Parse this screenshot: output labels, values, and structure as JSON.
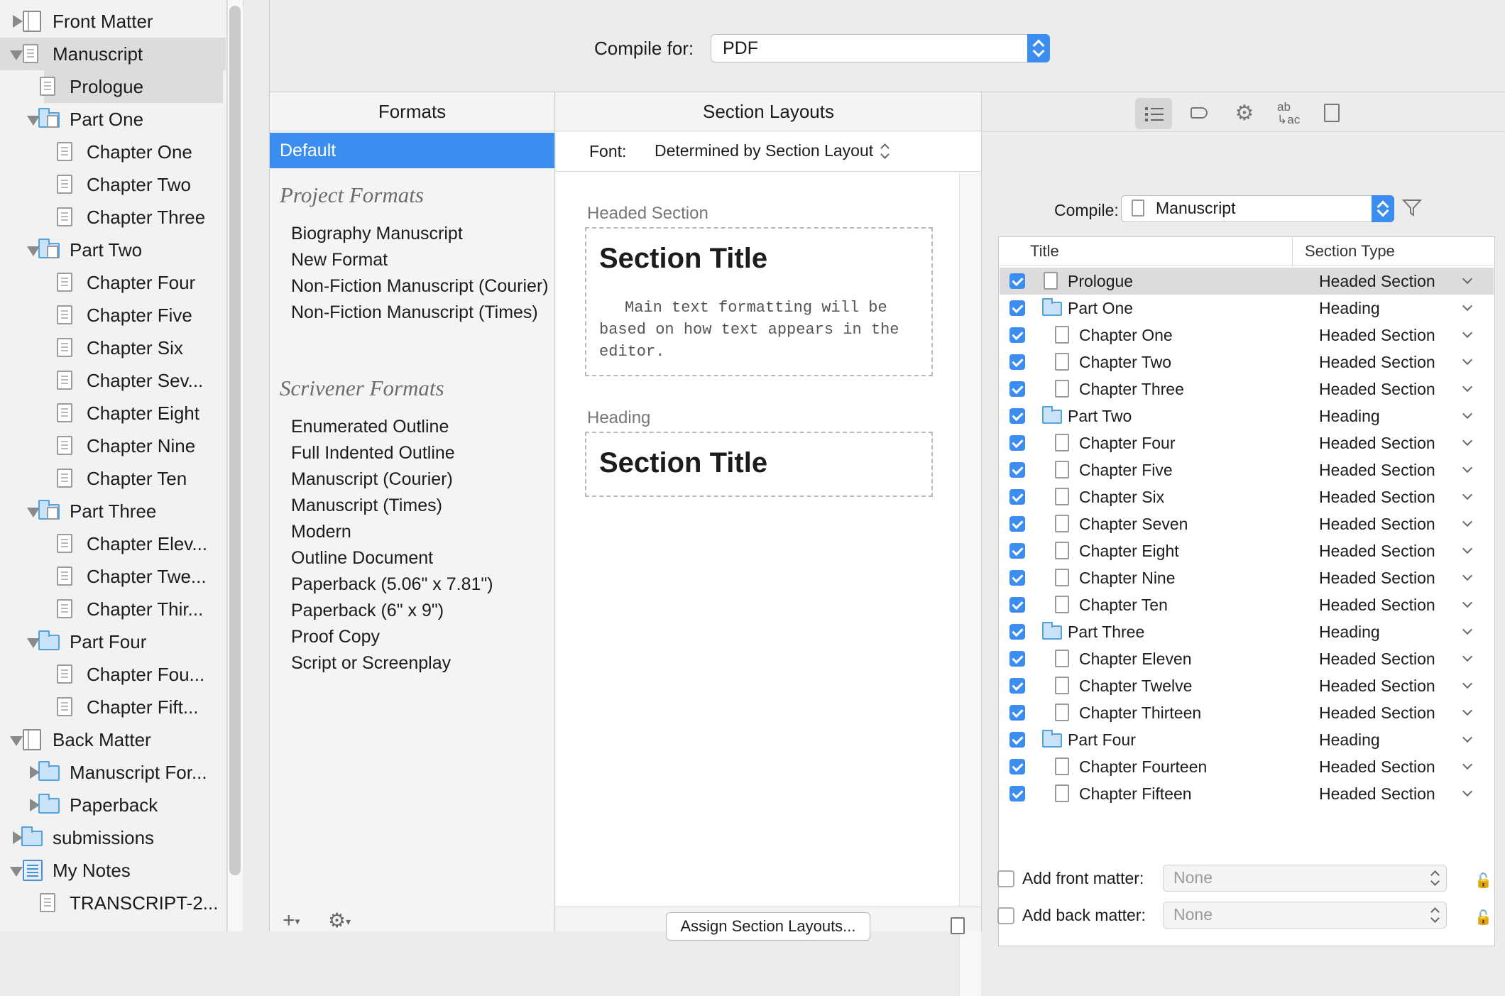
{
  "binder": {
    "items": [
      {
        "label": "Front Matter",
        "level": 0,
        "icon": "manuscript-icon",
        "tri": "c"
      },
      {
        "label": "Manuscript",
        "level": 0,
        "icon": "document-icon",
        "tri": "o",
        "selected": true
      },
      {
        "label": "Prologue",
        "level": 1,
        "icon": "document-icon",
        "tri": "",
        "selected2": true
      },
      {
        "label": "Part One",
        "level": 1,
        "icon": "folder-doc-icon",
        "tri": "o"
      },
      {
        "label": "Chapter One",
        "level": 2,
        "icon": "document-icon",
        "tri": ""
      },
      {
        "label": "Chapter Two",
        "level": 2,
        "icon": "document-icon",
        "tri": ""
      },
      {
        "label": "Chapter Three",
        "level": 2,
        "icon": "document-icon",
        "tri": ""
      },
      {
        "label": "Part Two",
        "level": 1,
        "icon": "folder-doc-icon",
        "tri": "o"
      },
      {
        "label": "Chapter Four",
        "level": 2,
        "icon": "document-icon",
        "tri": ""
      },
      {
        "label": "Chapter Five",
        "level": 2,
        "icon": "document-icon",
        "tri": ""
      },
      {
        "label": "Chapter Six",
        "level": 2,
        "icon": "document-icon",
        "tri": ""
      },
      {
        "label": "Chapter Sev...",
        "level": 2,
        "icon": "document-icon",
        "tri": ""
      },
      {
        "label": "Chapter Eight",
        "level": 2,
        "icon": "document-icon",
        "tri": ""
      },
      {
        "label": "Chapter Nine",
        "level": 2,
        "icon": "document-icon",
        "tri": ""
      },
      {
        "label": "Chapter Ten",
        "level": 2,
        "icon": "document-icon",
        "tri": ""
      },
      {
        "label": "Part Three",
        "level": 1,
        "icon": "folder-doc-icon",
        "tri": "o"
      },
      {
        "label": "Chapter Elev...",
        "level": 2,
        "icon": "document-icon",
        "tri": ""
      },
      {
        "label": "Chapter Twe...",
        "level": 2,
        "icon": "document-icon",
        "tri": ""
      },
      {
        "label": "Chapter Thir...",
        "level": 2,
        "icon": "document-icon",
        "tri": ""
      },
      {
        "label": "Part Four",
        "level": 1,
        "icon": "folder-icon",
        "tri": "o"
      },
      {
        "label": "Chapter Fou...",
        "level": 2,
        "icon": "document-icon",
        "tri": ""
      },
      {
        "label": "Chapter Fift...",
        "level": 2,
        "icon": "document-icon",
        "tri": ""
      },
      {
        "label": "Back Matter",
        "level": 0,
        "icon": "manuscript-icon",
        "tri": "o"
      },
      {
        "label": "Manuscript For...",
        "level": 1,
        "icon": "folder-icon",
        "tri": "c"
      },
      {
        "label": "Paperback",
        "level": 1,
        "icon": "folder-icon",
        "tri": "c"
      },
      {
        "label": "submissions",
        "level": 0,
        "icon": "folder-icon",
        "tri": "c"
      },
      {
        "label": "My Notes",
        "level": 0,
        "icon": "notebook-icon",
        "tri": "o"
      },
      {
        "label": "TRANSCRIPT-2...",
        "level": 1,
        "icon": "document-icon",
        "tri": ""
      }
    ]
  },
  "compile_for": {
    "label": "Compile for:",
    "value": "PDF"
  },
  "formats": {
    "header": "Formats",
    "default": "Default",
    "project_group": "Project Formats",
    "project": [
      "Biography Manuscript",
      "New Format",
      "Non-Fiction Manuscript (Courier)",
      "Non-Fiction Manuscript (Times)"
    ],
    "scrivener_group": "Scrivener Formats",
    "scrivener": [
      "Enumerated Outline",
      "Full Indented Outline",
      "Manuscript (Courier)",
      "Manuscript (Times)",
      "Modern",
      "Outline Document",
      "Paperback (5.06\" x 7.81\")",
      "Paperback (6\" x 9\")",
      "Proof Copy",
      "Script or Screenplay"
    ],
    "add_symbol": "+",
    "gear_symbol": "⚙"
  },
  "section_layouts": {
    "header": "Section Layouts",
    "font_label": "Font:",
    "font_value": "Determined by Section Layout",
    "layout1_name": "Headed Section",
    "layout1_title": "Section Title",
    "layout1_body": "Main text formatting will be based on how text appears in the editor.",
    "layout2_name": "Heading",
    "layout2_title": "Section Title",
    "assign_button": "Assign Section Layouts..."
  },
  "contents": {
    "compile_label": "Compile:",
    "compile_value": "Manuscript",
    "col_title": "Title",
    "col_type": "Section Type",
    "rows": [
      {
        "title": "Prologue",
        "type": "Headed Section",
        "kind": "doc",
        "indent": 0,
        "selected": true
      },
      {
        "title": "Part One",
        "type": "Heading",
        "kind": "folder",
        "indent": 0
      },
      {
        "title": "Chapter One",
        "type": "Headed Section",
        "kind": "doc",
        "indent": 1
      },
      {
        "title": "Chapter Two",
        "type": "Headed Section",
        "kind": "doc",
        "indent": 1
      },
      {
        "title": "Chapter Three",
        "type": "Headed Section",
        "kind": "doc",
        "indent": 1
      },
      {
        "title": "Part Two",
        "type": "Heading",
        "kind": "folder",
        "indent": 0
      },
      {
        "title": "Chapter Four",
        "type": "Headed Section",
        "kind": "doc",
        "indent": 1
      },
      {
        "title": "Chapter Five",
        "type": "Headed Section",
        "kind": "doc",
        "indent": 1
      },
      {
        "title": "Chapter Six",
        "type": "Headed Section",
        "kind": "doc",
        "indent": 1
      },
      {
        "title": "Chapter Seven",
        "type": "Headed Section",
        "kind": "doc",
        "indent": 1
      },
      {
        "title": "Chapter Eight",
        "type": "Headed Section",
        "kind": "doc",
        "indent": 1
      },
      {
        "title": "Chapter Nine",
        "type": "Headed Section",
        "kind": "doc",
        "indent": 1
      },
      {
        "title": "Chapter Ten",
        "type": "Headed Section",
        "kind": "doc",
        "indent": 1
      },
      {
        "title": "Part Three",
        "type": "Heading",
        "kind": "folder",
        "indent": 0
      },
      {
        "title": "Chapter Eleven",
        "type": "Headed Section",
        "kind": "doc",
        "indent": 1
      },
      {
        "title": "Chapter Twelve",
        "type": "Headed Section",
        "kind": "doc",
        "indent": 1
      },
      {
        "title": "Chapter Thirteen",
        "type": "Headed Section",
        "kind": "doc",
        "indent": 1
      },
      {
        "title": "Part Four",
        "type": "Heading",
        "kind": "folder",
        "indent": 0
      },
      {
        "title": "Chapter Fourteen",
        "type": "Headed Section",
        "kind": "doc",
        "indent": 1
      },
      {
        "title": "Chapter Fifteen",
        "type": "Headed Section",
        "kind": "doc",
        "indent": 1
      }
    ],
    "front_matter_label": "Add front matter:",
    "front_matter_value": "None",
    "back_matter_label": "Add back matter:",
    "back_matter_value": "None",
    "toolbar_icons": [
      "list-icon",
      "tag-icon",
      "gear-icon",
      "replacements-icon",
      "metadata-icon"
    ],
    "replacements_glyph": "ab ↳ac"
  },
  "colors": {
    "accent": "#3b8df0",
    "selection": "#dcdcdc",
    "folder": "#55a3dd"
  }
}
